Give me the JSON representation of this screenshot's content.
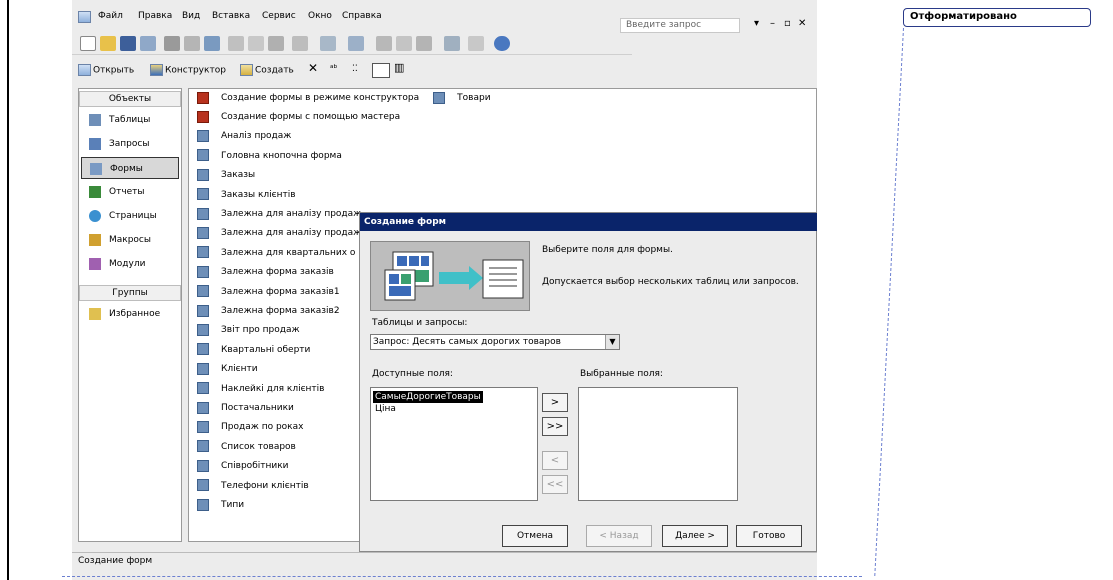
{
  "menu": {
    "file": "Файл",
    "edit": "Правка",
    "view": "Вид",
    "insert": "Вставка",
    "service": "Сервис",
    "window": "Окно",
    "help": "Справка",
    "ask_placeholder": "Введите запрос"
  },
  "dbbar": {
    "open": "Открыть",
    "design": "Конструктор",
    "create": "Создать"
  },
  "objects": {
    "header": "Объекты",
    "items": [
      "Таблицы",
      "Запросы",
      "Формы",
      "Отчеты",
      "Страницы",
      "Макросы",
      "Модули"
    ],
    "groups_header": "Группы",
    "favorites": "Избранное"
  },
  "forms_list": {
    "first": "Создание формы в режиме конструктора",
    "first_extra": "Товари",
    "items": [
      "Создание формы с помощью мастера",
      "Аналіз продаж",
      "Головна кнопочна форма",
      "Заказы",
      "Заказы клієнтів",
      "Залежна для аналізу продаж",
      "Залежна для аналізу продаж",
      "Залежна для квартальних о",
      "Залежна форма заказів",
      "Залежна форма заказів1",
      "Залежна форма заказів2",
      "Звіт про продаж",
      "Квартальні оберти",
      "Клієнти",
      "Наклейкі для клієнтів",
      "Постачальники",
      "Продаж по роках",
      "Список товаров",
      "Співробітники",
      "Телефони клієнтів",
      "Типи"
    ]
  },
  "status": "Создание форм",
  "dialog": {
    "title": "Создание форм",
    "hint1": "Выберите поля для формы.",
    "hint2": "Допускается выбор нескольких таблиц или запросов.",
    "tables_label": "Таблицы и запросы:",
    "combo_value": "Запрос: Десять самых дорогих товаров",
    "available_label": "Доступные поля:",
    "selected_label": "Выбранные поля:",
    "available_fields": [
      "СамыеДорогиеТовары",
      "Ціна"
    ],
    "move_one": ">",
    "move_all": ">>",
    "remove_one": "<",
    "remove_all": "<<",
    "cancel": "Отмена",
    "back": "< Назад",
    "next": "Далее >",
    "finish": "Готово"
  },
  "comment_tag": "Отформатировано"
}
